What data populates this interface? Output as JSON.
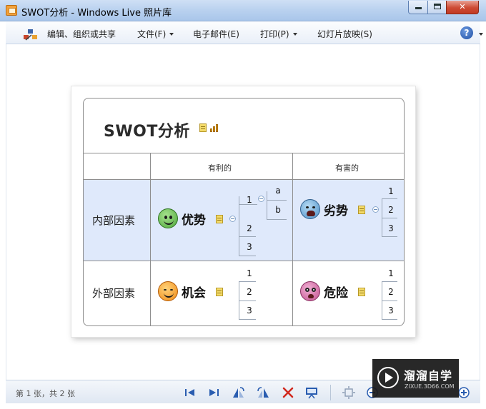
{
  "window": {
    "title": "SWOT分析 - Windows Live 照片库",
    "controls": {
      "minimize": "minimize",
      "maximize": "maximize",
      "close": "✕"
    }
  },
  "menu": {
    "items": [
      {
        "label": "编辑、组织或共享",
        "icon": "organize-icon"
      },
      {
        "label": "文件(F)",
        "dropdown": true
      },
      {
        "label": "电子邮件(E)",
        "dropdown": false
      },
      {
        "label": "打印(P)",
        "dropdown": true
      },
      {
        "label": "幻灯片放映(S)",
        "dropdown": false
      }
    ],
    "help": "?"
  },
  "image": {
    "title": "SWOT分析",
    "columns": [
      "有利的",
      "有害的"
    ],
    "rows": [
      "内部因素",
      "外部因素"
    ],
    "topics": {
      "strength": {
        "label": "优势",
        "icon": "happy-face-icon",
        "subtopics": [
          "1",
          "2",
          "3"
        ],
        "sub1_children": [
          "a",
          "b"
        ]
      },
      "weakness": {
        "label": "劣势",
        "icon": "crying-face-icon",
        "subtopics": [
          "1",
          "2",
          "3"
        ]
      },
      "opportunity": {
        "label": "机会",
        "icon": "laughing-face-icon",
        "subtopics": [
          "1",
          "2",
          "3"
        ]
      },
      "threat": {
        "label": "危险",
        "icon": "scared-face-icon",
        "subtopics": [
          "1",
          "2",
          "3"
        ]
      }
    },
    "colors": {
      "internal_row": "#dfe9fb",
      "border": "#8e8e8e"
    }
  },
  "statusbar": {
    "page_count": "第 1 张，共 2 张",
    "buttons": [
      "previous-icon",
      "next-icon",
      "rotate-left-icon",
      "rotate-right-icon",
      "delete-icon",
      "slideshow-icon",
      "actual-size-icon",
      "zoom-out-icon",
      "zoom-in-icon"
    ]
  },
  "watermark": {
    "title": "溜溜自学",
    "subtitle": "ZIXUE.3D66.COM"
  }
}
